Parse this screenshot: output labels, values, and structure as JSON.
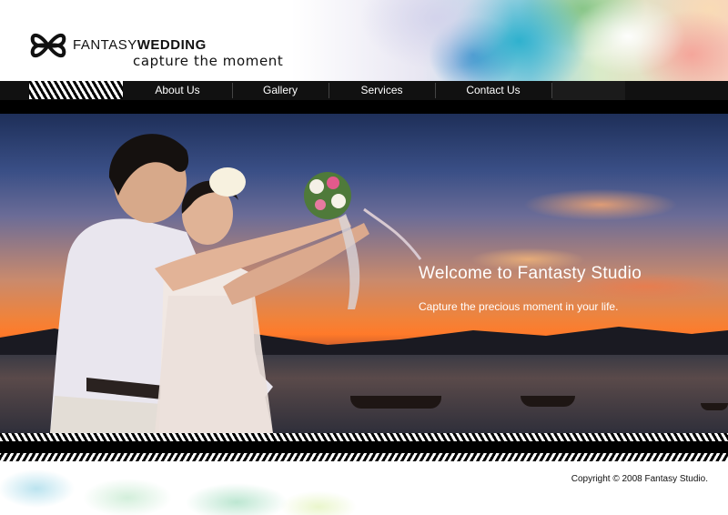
{
  "header": {
    "brand_light": "FANTASY",
    "brand_bold": "WEDDING",
    "tagline": "capture the moment"
  },
  "nav": {
    "items": [
      {
        "label": "About Us"
      },
      {
        "label": "Gallery"
      },
      {
        "label": "Services"
      },
      {
        "label": "Contact Us"
      }
    ]
  },
  "hero": {
    "welcome": "Welcome to Fantasty Studio",
    "subtitle": "Capture the precious moment in your life."
  },
  "footer": {
    "copyright": "Copyright © 2008 Fantasy Studio."
  },
  "colors": {
    "nav_background": "#000000",
    "text_on_hero": "#ffffff",
    "sunset_accent": "#ff7a2a"
  }
}
